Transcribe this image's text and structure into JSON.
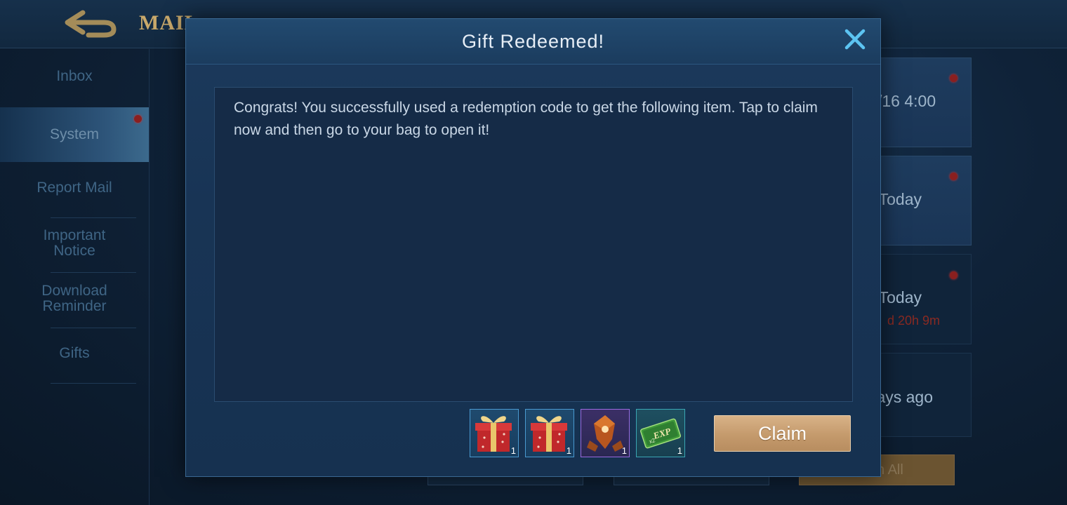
{
  "background": {
    "title": "MAIL",
    "sidebar": [
      {
        "label": "Inbox"
      },
      {
        "label": "System"
      },
      {
        "label": "Report Mail"
      },
      {
        "label": "Important Notice"
      },
      {
        "label": "Download Reminder"
      },
      {
        "label": "Gifts"
      }
    ],
    "mail_cards": [
      {
        "date": "/16 4:00",
        "sub": ""
      },
      {
        "date": "Today",
        "sub": ""
      },
      {
        "date": "Today",
        "sub": "d 20h 9m"
      },
      {
        "date": "ays ago",
        "sub": ""
      }
    ],
    "bottom_buttons": [
      {
        "label": ""
      },
      {
        "label": ""
      },
      {
        "label": "n All"
      }
    ]
  },
  "dialog": {
    "title": "Gift Redeemed!",
    "close_icon": "close-x-icon",
    "message": "Congrats! You successfully used a redemption code to get the following item. Tap to claim now and then go to your bag to open it!",
    "rewards": [
      {
        "icon": "gift-box-icon",
        "count": "1"
      },
      {
        "icon": "gift-box-icon",
        "count": "1"
      },
      {
        "icon": "emblem-fragment-icon",
        "count": "1"
      },
      {
        "icon": "exp-card-icon",
        "count": "1"
      }
    ],
    "claim_label": "Claim"
  },
  "colors": {
    "accent_gold": "#c9a96b",
    "claim_button": "#c49a6c",
    "dialog_border": "#3a6892",
    "close_icon": "#5cc4f2"
  }
}
